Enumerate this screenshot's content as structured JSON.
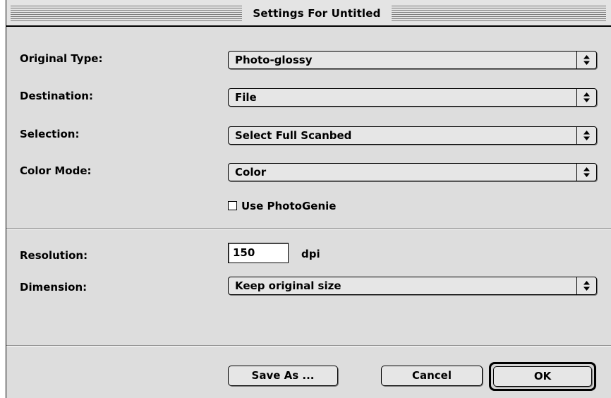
{
  "window": {
    "title": "Settings For Untitled"
  },
  "fields": {
    "original_type": {
      "label": "Original Type:",
      "value": "Photo-glossy"
    },
    "destination": {
      "label": "Destination:",
      "value": "File"
    },
    "selection": {
      "label": "Selection:",
      "value": "Select Full Scanbed"
    },
    "color_mode": {
      "label": "Color Mode:",
      "value": "Color"
    },
    "photogenie": {
      "label": "Use PhotoGenie",
      "checked": false
    },
    "resolution": {
      "label": "Resolution:",
      "value": "150",
      "unit": "dpi"
    },
    "dimension": {
      "label": "Dimension:",
      "value": "Keep original size"
    }
  },
  "buttons": {
    "save_as": "Save As ...",
    "cancel": "Cancel",
    "ok": "OK"
  },
  "icons": {
    "popup_arrow": "up-down-arrows-icon"
  }
}
